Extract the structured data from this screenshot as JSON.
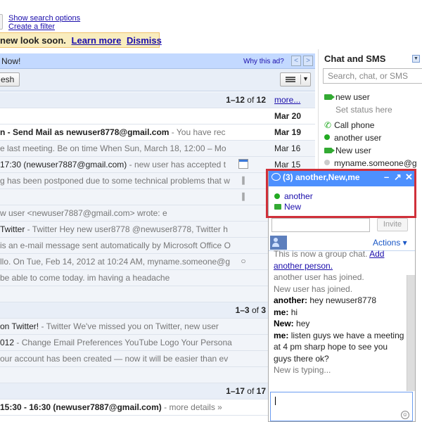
{
  "top": {
    "show_search_options": "Show search options",
    "create_filter": "Create a filter"
  },
  "notice": {
    "text": "new look soon.",
    "learn_more": "Learn more",
    "dismiss": "Dismiss"
  },
  "adbar": {
    "left_text": "Now!",
    "why_ad": "Why this ad?",
    "prev": "<",
    "next": ">"
  },
  "toolbar": {
    "refresh_label": "esh"
  },
  "inbox": {
    "rows": [
      {
        "kind": "hdr",
        "count": "1–12",
        "of": "of",
        "total": "12",
        "more": "more..."
      },
      {
        "kind": "unread",
        "subject": "",
        "snippet": "",
        "date": "Mar 20"
      },
      {
        "kind": "unread",
        "subject": "n - Send Mail as newuser8778@gmail.com",
        "snippet": " - You have rec",
        "date": "Mar 19"
      },
      {
        "kind": "read",
        "subject": "",
        "snippet": "e last meeting. Be on time When Sun, March 18, 12:00 – Mo",
        "date": "Mar 16"
      },
      {
        "kind": "read",
        "subject": "17:30 (newuser7887@gmail.com)",
        "snippet": " - new user has accepted t",
        "date": "Mar 15",
        "icon": "calendar"
      },
      {
        "kind": "read",
        "subject": "",
        "snippet": "g has been postponed due to some technical problems that w",
        "date": "",
        "icon": "clip"
      },
      {
        "kind": "read",
        "subject": "",
        "snippet": "",
        "date": "",
        "icon": "clip"
      },
      {
        "kind": "read",
        "subject": "",
        "snippet": "w user <newuser7887@gmail.com> wrote: e",
        "date": ""
      },
      {
        "kind": "read",
        "subject": "Twitter",
        "snippet": " - Twitter Hey new user8778 @newuser8778, Twitter h",
        "date": ""
      },
      {
        "kind": "read",
        "subject": "",
        "snippet": "is an e-mail message sent automatically by Microsoft Office O",
        "date": ""
      },
      {
        "kind": "read",
        "subject": "",
        "snippet": "llo. On Tue, Feb 14, 2012 at 10:24 AM, myname.someone@g",
        "date": "",
        "icon": "chat"
      },
      {
        "kind": "read",
        "subject": "",
        "snippet": "be able to come today. im having a headache",
        "date": ""
      },
      {
        "kind": "read",
        "subject": "",
        "snippet": "",
        "date": ""
      },
      {
        "kind": "hdr",
        "count": "1–3",
        "of": "of",
        "total": "3"
      },
      {
        "kind": "read",
        "subject": "on Twitter!",
        "snippet": " - Twitter We've missed you on Twitter, new user",
        "date": ""
      },
      {
        "kind": "read",
        "subject": "012",
        "snippet": " - Change Email Preferences YouTube Logo Your Persona",
        "date": ""
      },
      {
        "kind": "read",
        "subject": "",
        "snippet": "our account has been created — now it will be easier than ev",
        "date": ""
      },
      {
        "kind": "read",
        "subject": "",
        "snippet": "",
        "date": ""
      },
      {
        "kind": "hdr",
        "count": "1–17",
        "of": "of",
        "total": "17"
      },
      {
        "kind": "unread",
        "subject": "15:30 - 16:30 (newuser7887@gmail.com)",
        "snippet": " - more details »",
        "date": ""
      }
    ]
  },
  "chat": {
    "title": "Chat and SMS",
    "search_placeholder": "Search, chat, or SMS",
    "me": "new user",
    "set_status": "Set status here",
    "contacts": [
      {
        "label": "Call phone",
        "icon": "phone-icon"
      },
      {
        "label": "another user",
        "icon": "online-dot-icon"
      },
      {
        "label": "New user",
        "icon": "video-icon"
      },
      {
        "label": "myname.someone@g",
        "icon": "offline-dot-icon"
      }
    ],
    "colors": {
      "header": "#4d90fe",
      "online": "#2a2",
      "highlight": "#d0303a"
    }
  },
  "group_chat": {
    "title": "(3) another,New,me",
    "members": [
      {
        "name": "another",
        "icon": "online-dot-icon"
      },
      {
        "name": "New",
        "icon": "video-icon"
      }
    ],
    "invite_label": "Invite",
    "actions_label": "Actions ▾",
    "messages": [
      {
        "type": "sys",
        "text": "This is now a group chat.",
        "link": "Add another person."
      },
      {
        "type": "sys",
        "text": "another user has joined."
      },
      {
        "type": "sys",
        "text": "New user has joined."
      },
      {
        "type": "msg",
        "from": "another:",
        "text": "hey newuser8778"
      },
      {
        "type": "msg",
        "from": "me:",
        "text": "hi"
      },
      {
        "type": "msg",
        "from": "New:",
        "text": "hey"
      },
      {
        "type": "msg",
        "from": "me:",
        "text": "listen guys we have a meeting at 4 pm sharp hope to see you guys there ok?"
      },
      {
        "type": "sys",
        "text": "New is typing..."
      }
    ]
  }
}
